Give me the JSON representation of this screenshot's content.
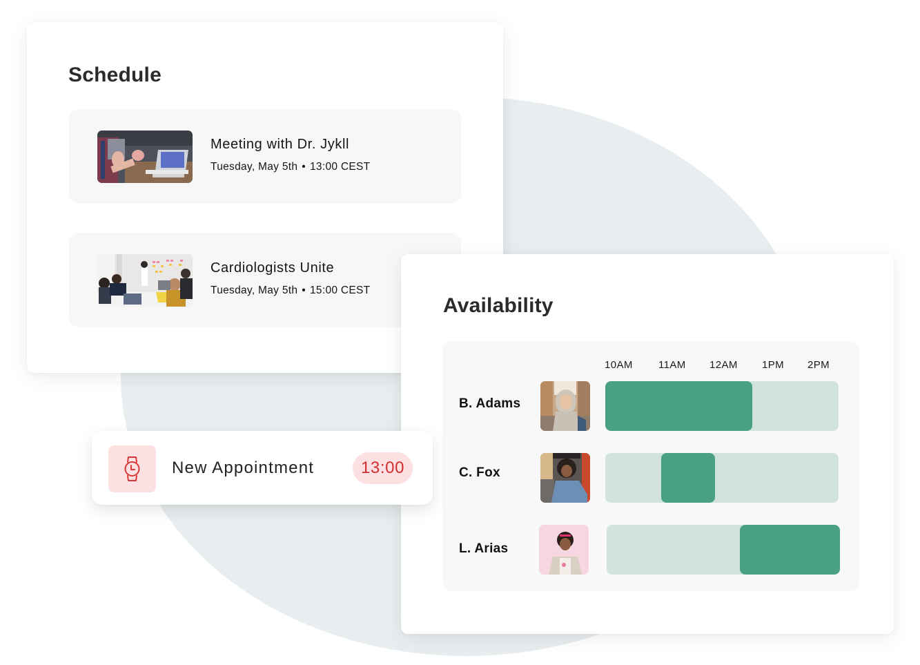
{
  "schedule": {
    "title": "Schedule",
    "items": [
      {
        "title": "Meeting with Dr. Jykll",
        "date": "Tuesday, May 5th",
        "separator": "•",
        "time": "13:00 CEST",
        "image": "meeting-laptop-photo"
      },
      {
        "title": "Cardiologists Unite",
        "date": "Tuesday, May 5th",
        "separator": "•",
        "time": "15:00 CEST",
        "image": "team-whiteboard-photo"
      }
    ]
  },
  "appointment": {
    "icon": "watch-icon",
    "label": "New Appointment",
    "time": "13:00"
  },
  "availability": {
    "title": "Availability",
    "hours": [
      "10AM",
      "11AM",
      "12AM",
      "1PM",
      "2PM"
    ],
    "people": [
      {
        "name": "B. Adams",
        "avatar": "woman-hijab-photo",
        "available_from": 0.0,
        "available_to": 0.63
      },
      {
        "name": "C. Fox",
        "avatar": "woman-glasses-denim-photo",
        "available_from": 0.24,
        "available_to": 0.47
      },
      {
        "name": "L. Arias",
        "avatar": "woman-pink-background-photo",
        "available_from": 0.57,
        "available_to": 1.0
      }
    ]
  },
  "colors": {
    "available": "#4aa082",
    "unavailable": "#d0e3dd",
    "accent_red": "#d22e2e",
    "accent_red_bg": "#fde0e1"
  }
}
